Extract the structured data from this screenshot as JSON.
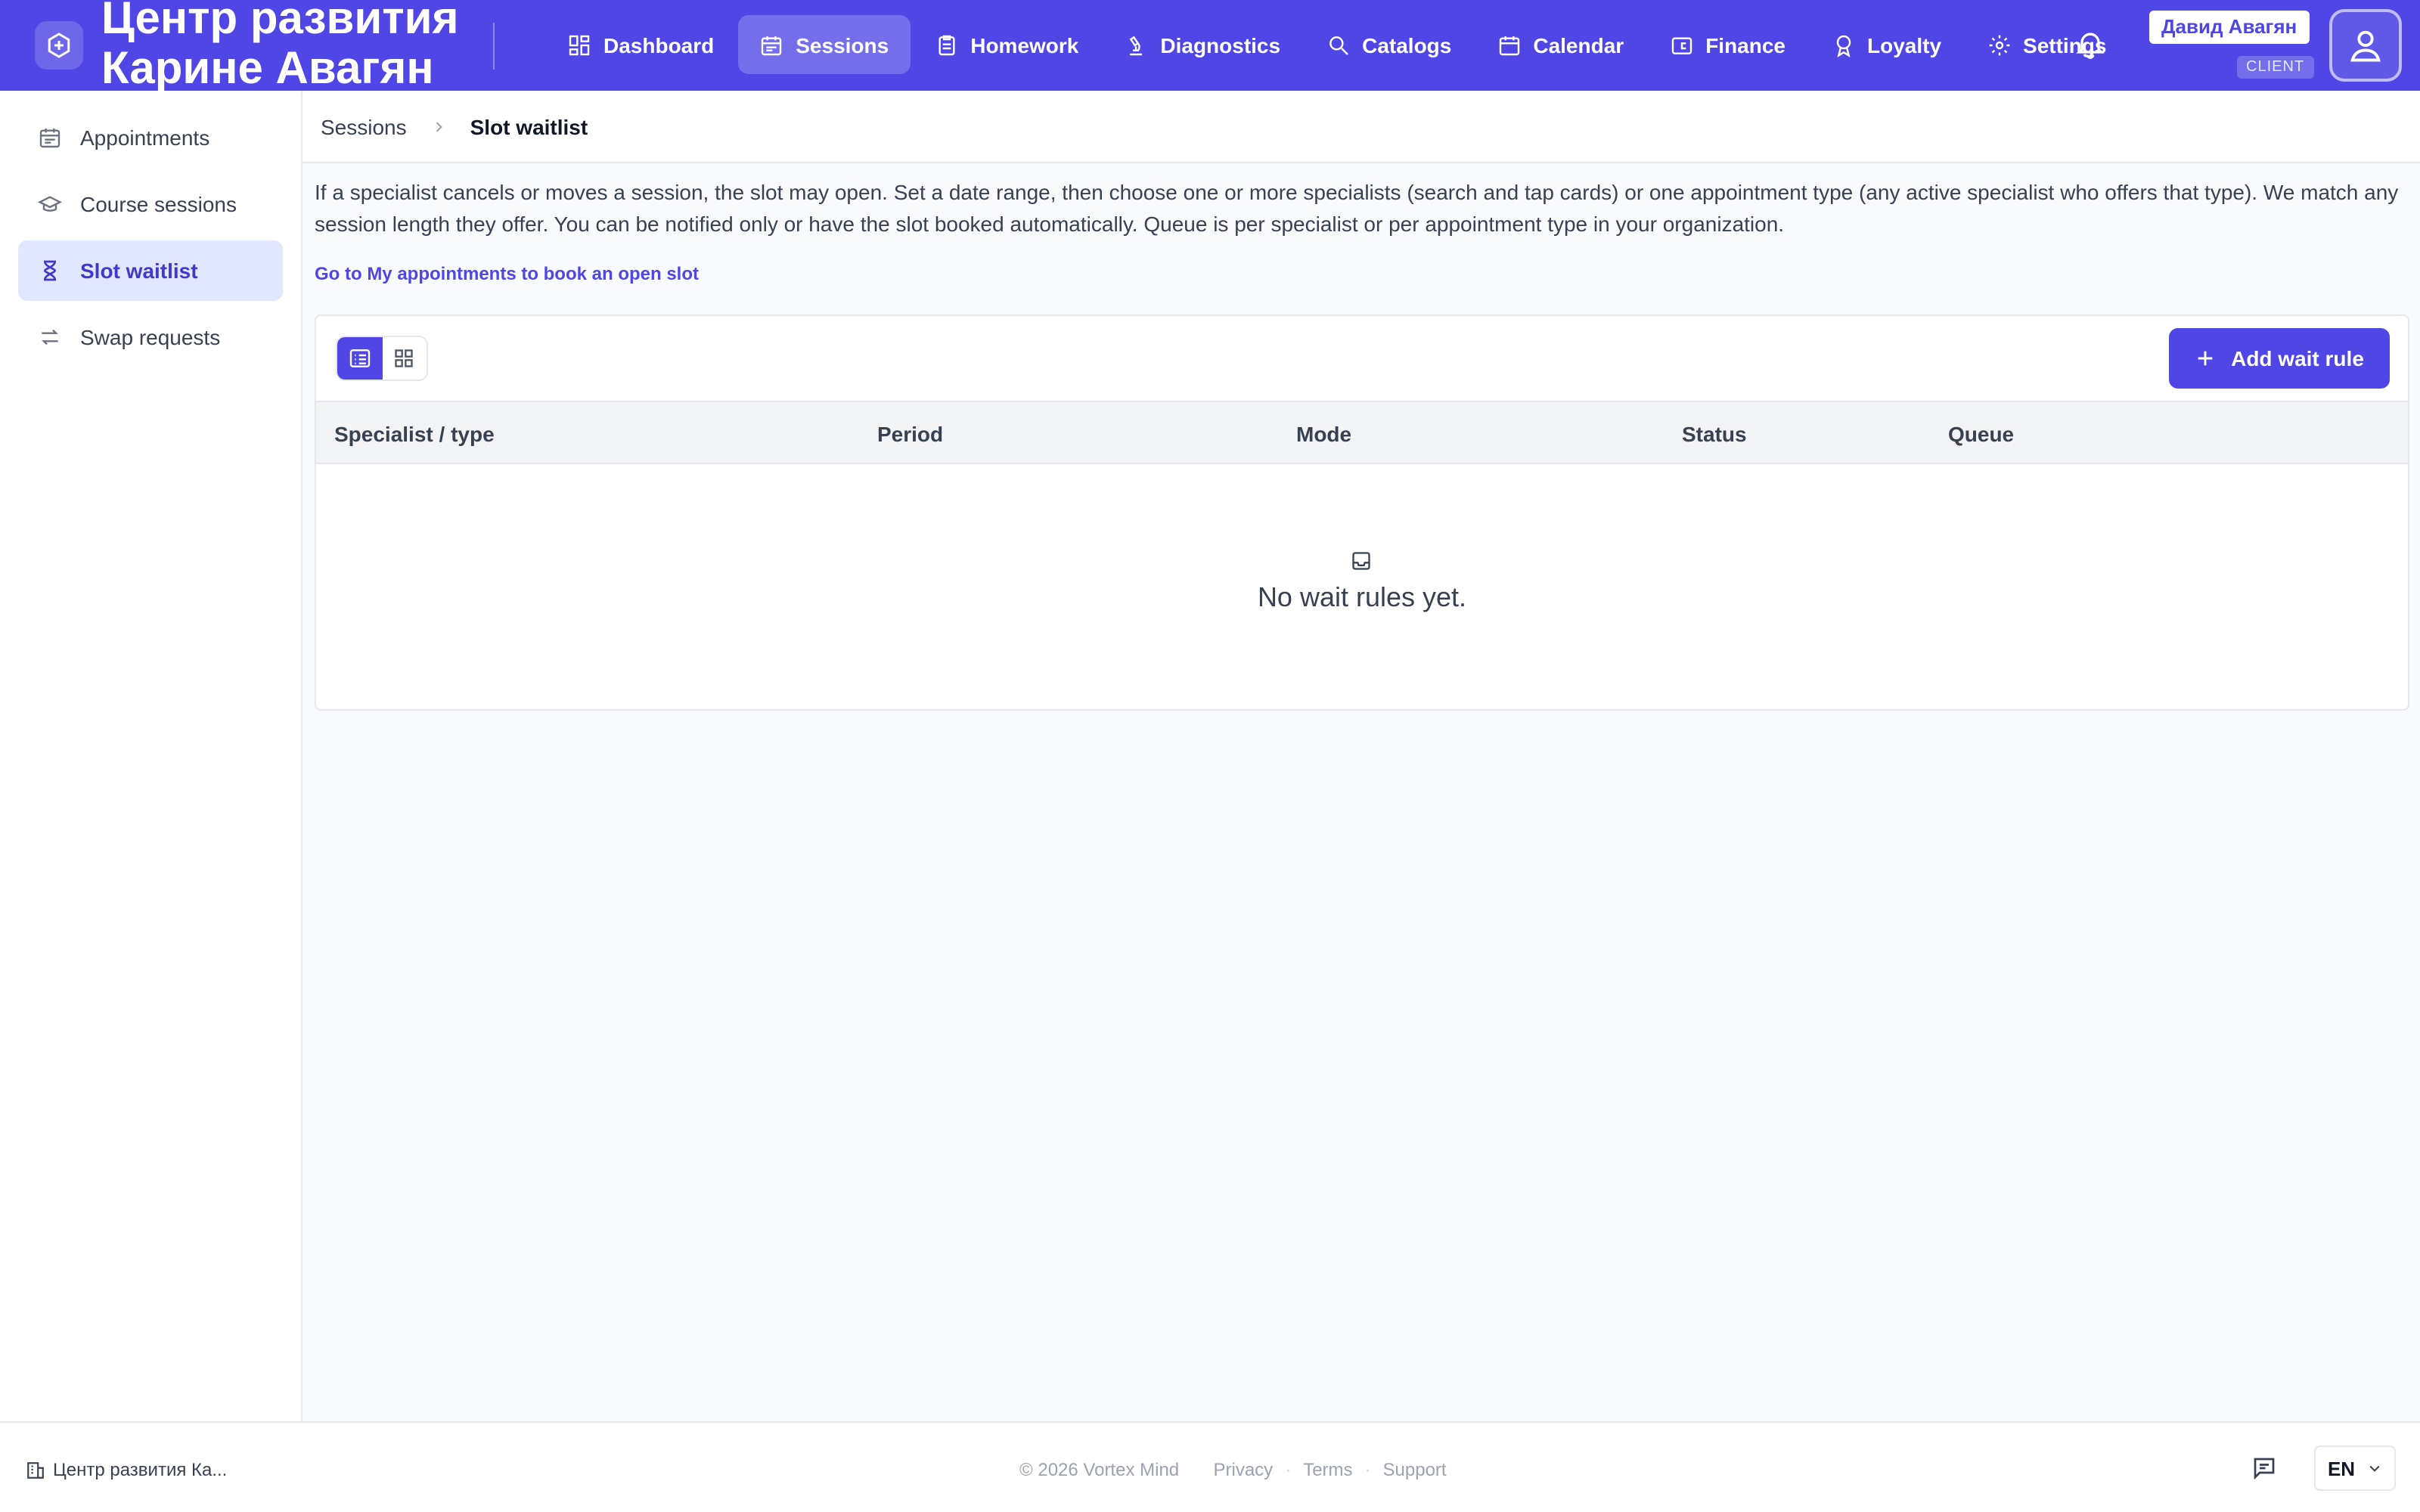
{
  "app": {
    "title": "Центр развития\nКарине Авагян",
    "brand_color": "#4f46e5"
  },
  "nav": {
    "items": [
      {
        "label": "Dashboard",
        "icon": "dashboard-icon"
      },
      {
        "label": "Sessions",
        "icon": "sessions-icon",
        "active": true
      },
      {
        "label": "Homework",
        "icon": "homework-icon"
      },
      {
        "label": "Diagnostics",
        "icon": "diagnostics-icon"
      },
      {
        "label": "Catalogs",
        "icon": "search-icon"
      },
      {
        "label": "Calendar",
        "icon": "calendar-icon"
      },
      {
        "label": "Finance",
        "icon": "wallet-icon"
      },
      {
        "label": "Loyalty",
        "icon": "award-icon"
      },
      {
        "label": "Settings",
        "icon": "gear-icon"
      }
    ]
  },
  "user": {
    "name": "Давид Авагян",
    "role": "CLIENT"
  },
  "sidebar": {
    "items": [
      {
        "label": "Appointments",
        "icon": "calendar-icon"
      },
      {
        "label": "Course sessions",
        "icon": "graduation-cap-icon"
      },
      {
        "label": "Slot waitlist",
        "icon": "hourglass-icon",
        "active": true
      },
      {
        "label": "Swap requests",
        "icon": "swap-icon"
      }
    ]
  },
  "breadcrumb": {
    "parent": "Sessions",
    "current": "Slot waitlist"
  },
  "page": {
    "intro": "If a specialist cancels or moves a session, the slot may open. Set a date range, then choose one or more specialists (search and tap cards) or one appointment type (any active specialist who offers that type). We match any session length they offer. You can be notified only or have the slot booked automatically. Queue is per specialist or per appointment type in your organization.",
    "book_link": "Go to My appointments to book an open slot",
    "add_button": "Add wait rule",
    "table": {
      "columns": [
        "Specialist / type",
        "Period",
        "Mode",
        "Status",
        "Queue"
      ],
      "rows": [],
      "empty_text": "No wait rules yet."
    }
  },
  "footer": {
    "org": "Центр развития Ка...",
    "copyright": "© 2026 Vortex Mind",
    "links": [
      "Privacy",
      "Terms",
      "Support"
    ],
    "language": "EN"
  }
}
